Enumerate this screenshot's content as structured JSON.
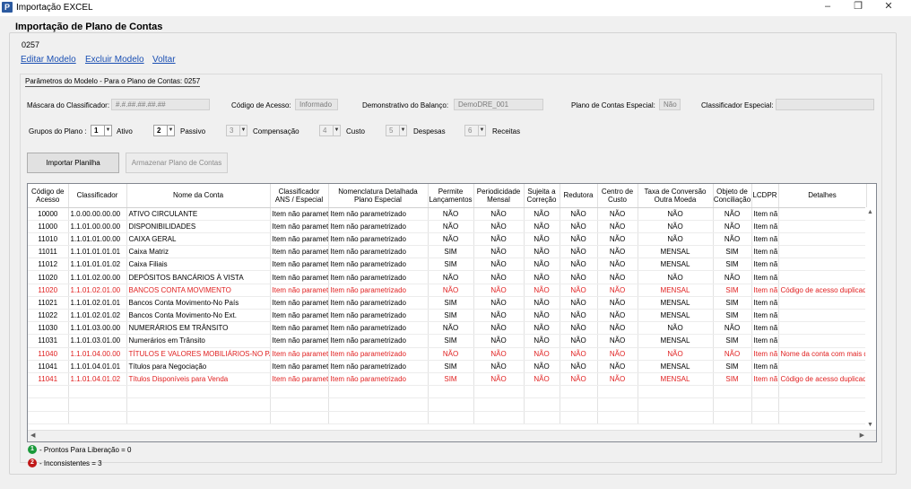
{
  "window": {
    "title": "Importação EXCEL",
    "icon": "app-icon",
    "minimize": "–",
    "restore": "❐",
    "close": "✕"
  },
  "header": {
    "title": "Importação de Plano de Contas",
    "code": "0257"
  },
  "links": {
    "edit": "Editar Modelo",
    "delete": "Excluir Modelo",
    "back": "Voltar"
  },
  "params": {
    "legend": "Parâmetros do Modelo -   Para o Plano de Contas: 0257",
    "mask_label": "Máscara do Classificador:",
    "mask_value": "#.#.##.##.##.##",
    "access_label": "Código de Acesso:",
    "access_value": "Informado",
    "balance_label": "Demonstrativo do Balanço:",
    "balance_value": "DemoDRE_001",
    "special_label": "Plano de Contas Especial:",
    "special_value": "Não",
    "classif_label": "Classificador  Especial:",
    "classif_value": ""
  },
  "groups": {
    "label": "Grupos do Plano :",
    "items": [
      {
        "value": "1",
        "name": "Ativo"
      },
      {
        "value": "2",
        "name": "Passivo"
      },
      {
        "value": "3",
        "name": "Compensação"
      },
      {
        "value": "4",
        "name": "Custo"
      },
      {
        "value": "5",
        "name": "Despesas"
      },
      {
        "value": "6",
        "name": "Receitas"
      }
    ]
  },
  "buttons": {
    "import": "Importar Planilha",
    "store": "Armazenar Plano de Contas"
  },
  "table": {
    "headers": [
      "Código de Acesso",
      "Classificador",
      "Nome da Conta",
      "Classificador ANS / Especial",
      "Nomenclatura Detalhada Plano Especial",
      "Permite Lançamentos",
      "Periodicidade Mensal",
      "Sujeita a Correção",
      "Redutora",
      "Centro de Custo",
      "Taxa de Conversão Outra Moeda",
      "Objeto de Conciliação",
      "LCDPR",
      "Detalhes"
    ],
    "rows": [
      {
        "err": false,
        "cells": [
          "10000",
          "1.0.00.00.00.00",
          "ATIVO CIRCULANTE",
          "Item não paramet",
          "Item não parametrizado",
          "NÃO",
          "NÃO",
          "NÃO",
          "NÃO",
          "NÃO",
          "NÃO",
          "NÃO",
          "Item nã",
          ""
        ]
      },
      {
        "err": false,
        "cells": [
          "11000",
          "1.1.01.00.00.00",
          "DISPONIBILIDADES",
          "Item não paramet",
          "Item não parametrizado",
          "NÃO",
          "NÃO",
          "NÃO",
          "NÃO",
          "NÃO",
          "NÃO",
          "NÃO",
          "Item nã",
          ""
        ]
      },
      {
        "err": false,
        "cells": [
          "11010",
          "1.1.01.01.00.00",
          "CAIXA GERAL",
          "Item não paramet",
          "Item não parametrizado",
          "NÃO",
          "NÃO",
          "NÃO",
          "NÃO",
          "NÃO",
          "NÃO",
          "NÃO",
          "Item nã",
          ""
        ]
      },
      {
        "err": false,
        "cells": [
          "11011",
          "1.1.01.01.01.01",
          "Caixa Matriz",
          "Item não paramet",
          "Item não parametrizado",
          "SIM",
          "NÃO",
          "NÃO",
          "NÃO",
          "NÃO",
          "MENSAL",
          "SIM",
          "Item nã",
          ""
        ]
      },
      {
        "err": false,
        "cells": [
          "11012",
          "1.1.01.01.01.02",
          "Caixa Filiais",
          "Item não paramet",
          "Item não parametrizado",
          "SIM",
          "NÃO",
          "NÃO",
          "NÃO",
          "NÃO",
          "MENSAL",
          "SIM",
          "Item nã",
          ""
        ]
      },
      {
        "err": false,
        "cells": [
          "11020",
          "1.1.01.02.00.00",
          "DEPÓSITOS BANCÁRIOS À VISTA",
          "Item não paramet",
          "Item não parametrizado",
          "NÃO",
          "NÃO",
          "NÃO",
          "NÃO",
          "NÃO",
          "NÃO",
          "NÃO",
          "Item nã",
          ""
        ]
      },
      {
        "err": true,
        "cells": [
          "11020",
          "1.1.01.02.01.00",
          "BANCOS CONTA MOVIMENTO",
          "Item não paramet",
          "Item não parametrizado",
          "NÃO",
          "NÃO",
          "NÃO",
          "NÃO",
          "NÃO",
          "MENSAL",
          "SIM",
          "Item nã",
          "Código de acesso duplicad"
        ]
      },
      {
        "err": false,
        "cells": [
          "11021",
          "1.1.01.02.01.01",
          "Bancos Conta Movimento-No País",
          "Item não paramet",
          "Item não parametrizado",
          "SIM",
          "NÃO",
          "NÃO",
          "NÃO",
          "NÃO",
          "MENSAL",
          "SIM",
          "Item nã",
          ""
        ]
      },
      {
        "err": false,
        "cells": [
          "11022",
          "1.1.01.02.01.02",
          "Bancos Conta Movimento-No Ext.",
          "Item não paramet",
          "Item não parametrizado",
          "SIM",
          "NÃO",
          "NÃO",
          "NÃO",
          "NÃO",
          "MENSAL",
          "SIM",
          "Item nã",
          ""
        ]
      },
      {
        "err": false,
        "cells": [
          "11030",
          "1.1.01.03.00.00",
          "NUMERÁRIOS EM TRÂNSITO",
          "Item não paramet",
          "Item não parametrizado",
          "NÃO",
          "NÃO",
          "NÃO",
          "NÃO",
          "NÃO",
          "NÃO",
          "NÃO",
          "Item nã",
          ""
        ]
      },
      {
        "err": false,
        "cells": [
          "11031",
          "1.1.01.03.01.00",
          "Numerários em Trânsito",
          "Item não paramet",
          "Item não parametrizado",
          "SIM",
          "NÃO",
          "NÃO",
          "NÃO",
          "NÃO",
          "MENSAL",
          "SIM",
          "Item nã",
          ""
        ]
      },
      {
        "err": true,
        "cells": [
          "11040",
          "1.1.01.04.00.00",
          "TÍTULOS E VALORES MOBILIÁRIOS-NO PAÍS",
          "Item não paramet",
          "Item não parametrizado",
          "NÃO",
          "NÃO",
          "NÃO",
          "NÃO",
          "NÃO",
          "NÃO",
          "NÃO",
          "Item nã",
          "Nome da conta com mais d"
        ]
      },
      {
        "err": false,
        "cells": [
          "11041",
          "1.1.01.04.01.01",
          "Títulos para Negociação",
          "Item não paramet",
          "Item não parametrizado",
          "SIM",
          "NÃO",
          "NÃO",
          "NÃO",
          "NÃO",
          "MENSAL",
          "SIM",
          "Item nã",
          ""
        ]
      },
      {
        "err": true,
        "cells": [
          "11041",
          "1.1.01.04.01.02",
          "Títulos Disponíveis para Venda",
          "Item não paramet",
          "Item não parametrizado",
          "SIM",
          "NÃO",
          "NÃO",
          "NÃO",
          "NÃO",
          "MENSAL",
          "SIM",
          "Item nã",
          "Código de acesso duplicad"
        ]
      }
    ],
    "empty_rows": 3
  },
  "legend": {
    "ready": {
      "num": "1",
      "text": "- Prontos Para Liberação = 0",
      "color": "#1a9a3a"
    },
    "inconsistent": {
      "num": "2",
      "text": "- Inconsistentes = 3",
      "color": "#c01818"
    }
  },
  "colors": {
    "error_text": "#e02020",
    "link": "#1a4fb3"
  }
}
